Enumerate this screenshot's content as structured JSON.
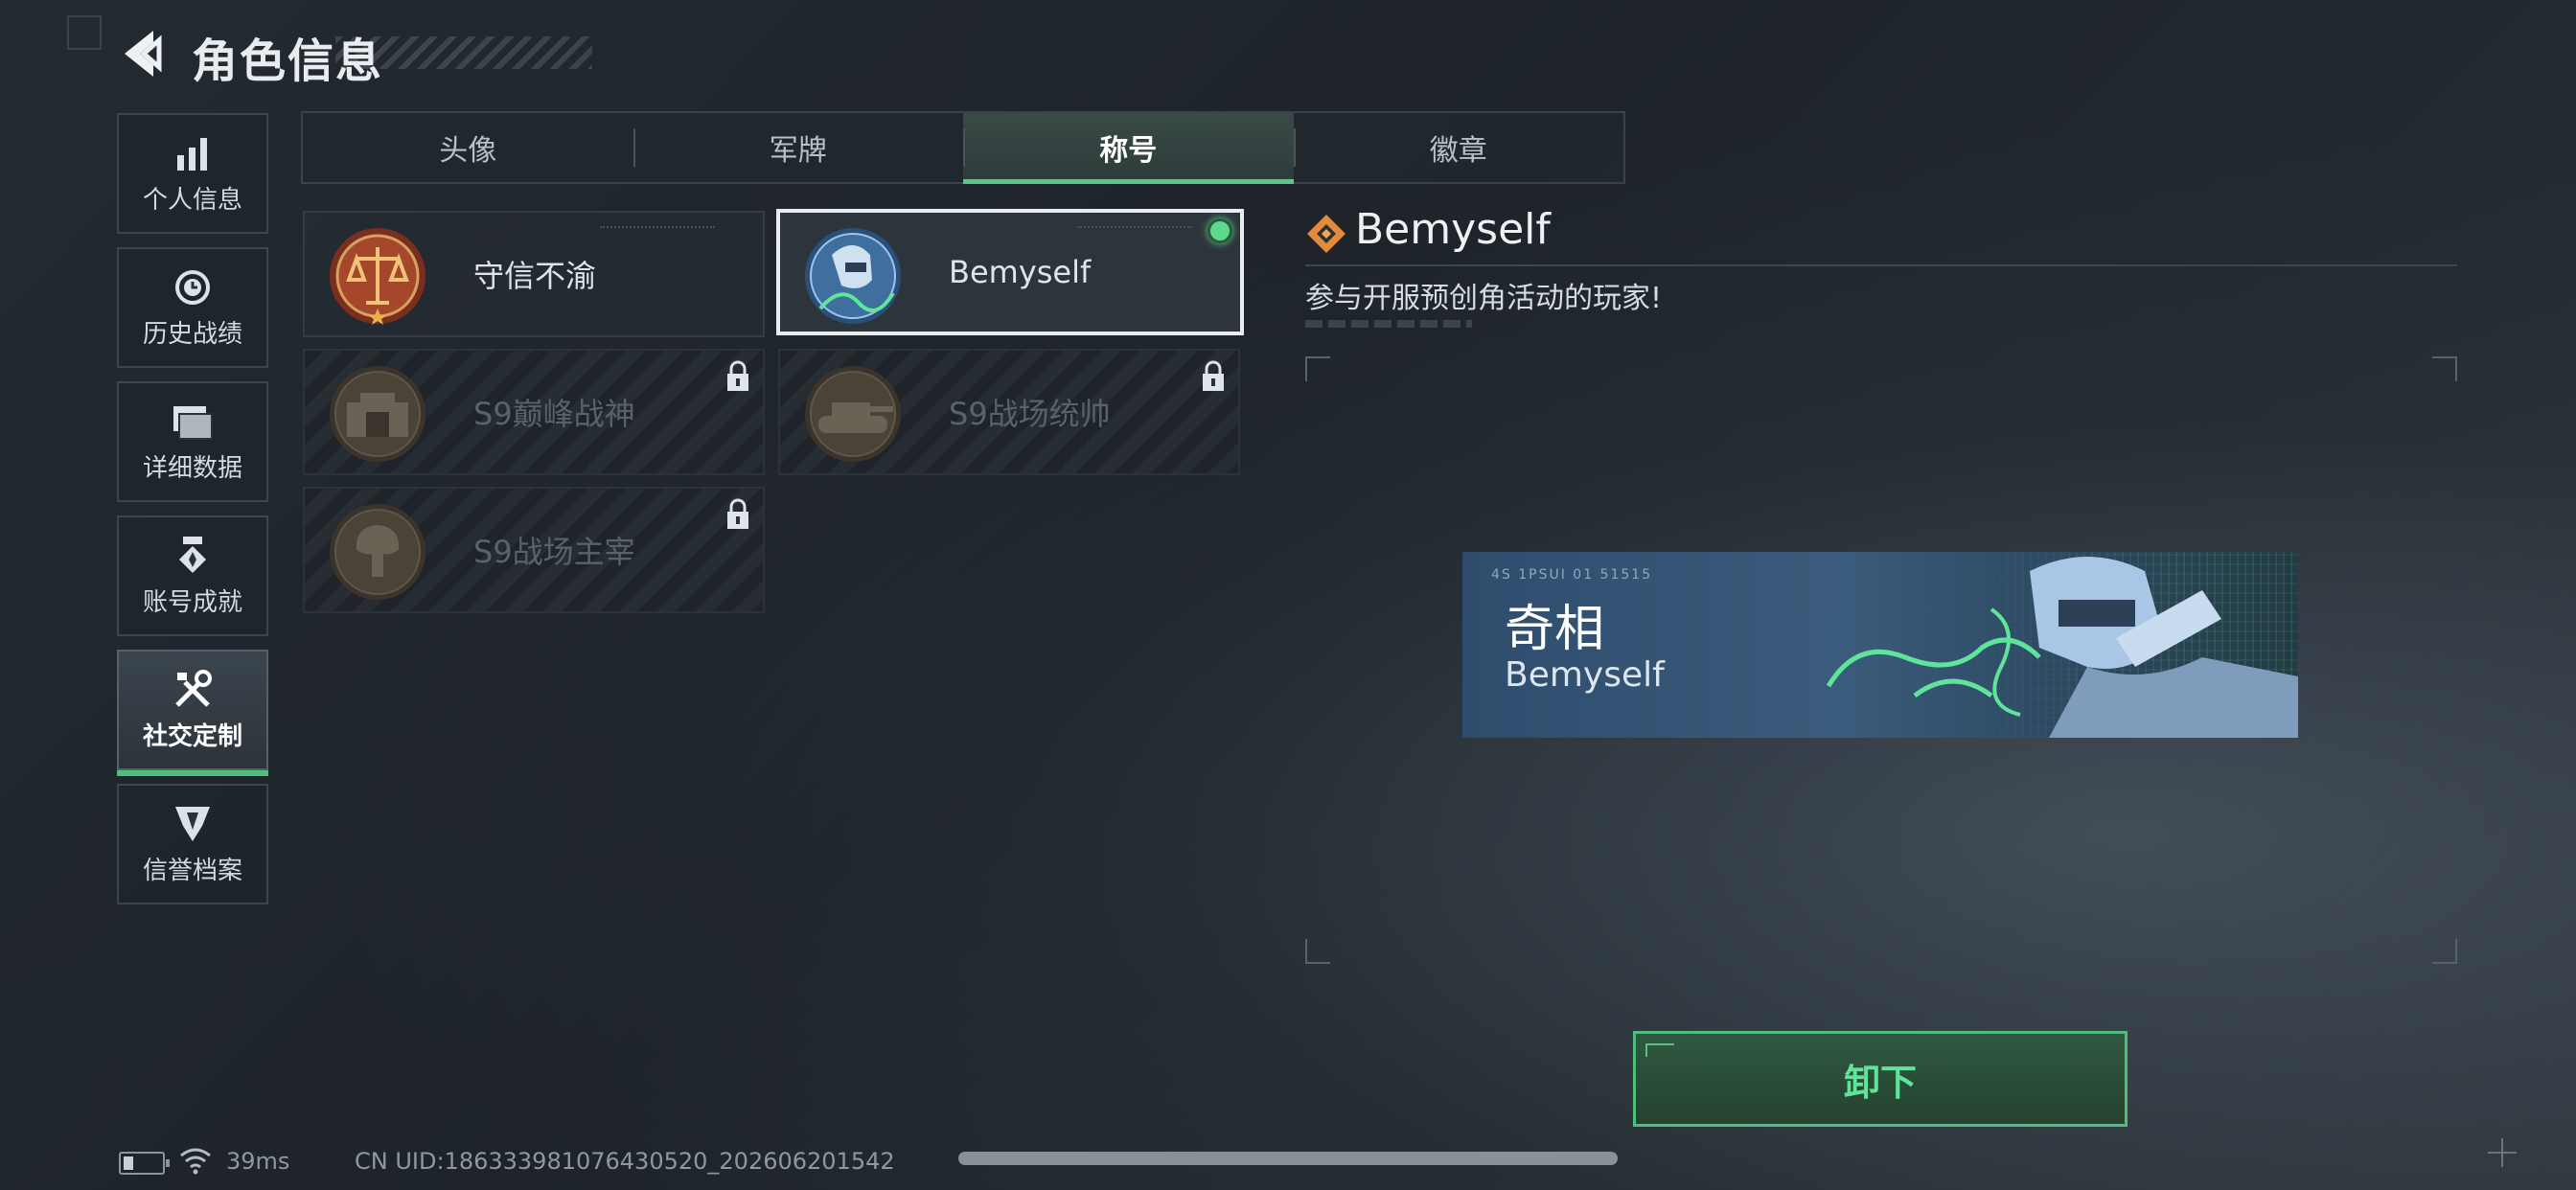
{
  "header": {
    "title": "角色信息"
  },
  "sidebar": {
    "items": [
      {
        "label": "个人信息",
        "icon": "bar-chart-icon"
      },
      {
        "label": "历史战绩",
        "icon": "history-clock-icon"
      },
      {
        "label": "详细数据",
        "icon": "folder-icon"
      },
      {
        "label": "账号成就",
        "icon": "medal-icon"
      },
      {
        "label": "社交定制",
        "icon": "tools-icon",
        "active": true
      },
      {
        "label": "信誉档案",
        "icon": "reputation-emblem-icon"
      }
    ]
  },
  "tabs": [
    {
      "label": "头像"
    },
    {
      "label": "军牌"
    },
    {
      "label": "称号",
      "active": true
    },
    {
      "label": "徽章"
    }
  ],
  "titles": [
    {
      "name": "守信不渝",
      "locked": false,
      "emblem": "scales-emblem-icon"
    },
    {
      "name": "Bemyself",
      "locked": false,
      "selected": true,
      "equipped": true,
      "emblem": "soldier-emblem-icon"
    },
    {
      "name": "S9巅峰战神",
      "locked": true,
      "emblem": "fortress-emblem-icon"
    },
    {
      "name": "S9战场统帅",
      "locked": true,
      "emblem": "tank-emblem-icon"
    },
    {
      "name": "S9战场主宰",
      "locked": true,
      "emblem": "explosion-emblem-icon"
    }
  ],
  "detail": {
    "name": "Bemyself",
    "description": "参与开服预创角活动的玩家!",
    "banner": {
      "title": "奇相",
      "subtitle": "Bemyself",
      "code": "4S 1PSUI 01 51515"
    },
    "action_label": "卸下"
  },
  "footer": {
    "ping": "39ms",
    "uid": "CN UID:186333981076430520_202606201542"
  },
  "colors": {
    "accent_green": "#57c987",
    "background": "#1f262c",
    "equipped_dot": "#5dd98b"
  }
}
